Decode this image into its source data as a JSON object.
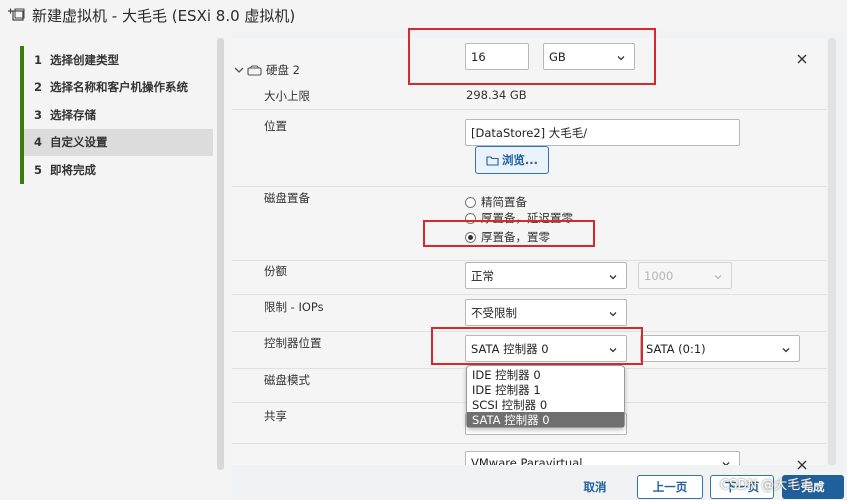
{
  "window": {
    "title": "新建虚拟机 - 大毛毛 (ESXi 8.0 虚拟机)"
  },
  "steps": [
    {
      "num": "1",
      "label": "选择创建类型"
    },
    {
      "num": "2",
      "label": "选择名称和客户机操作系统"
    },
    {
      "num": "3",
      "label": "选择存储"
    },
    {
      "num": "4",
      "label": "自定义设置"
    },
    {
      "num": "5",
      "label": "即将完成"
    }
  ],
  "disk": {
    "title": "硬盘 2",
    "size_value": "16",
    "size_unit": "GB",
    "max_label": "大小上限",
    "max_value": "298.34 GB",
    "location_label": "位置",
    "location_value": "[DataStore2] 大毛毛/",
    "browse_label": "浏览...",
    "provision_label": "磁盘置备",
    "provision_options": [
      "精简置备",
      "厚置备，延迟置零",
      "厚置备，置零"
    ],
    "shares_label": "份额",
    "shares_value": "正常",
    "shares_number": "1000",
    "limit_label": "限制 - IOPs",
    "limit_value": "不受限制",
    "controller_label": "控制器位置",
    "controller_value": "SATA 控制器 0",
    "controller_slot": "SATA (0:1)",
    "controller_options": [
      "IDE 控制器 0",
      "IDE 控制器 1",
      "SCSI 控制器 0",
      "SATA 控制器 0"
    ],
    "mode_label": "磁盘模式",
    "share_label": "共享"
  },
  "next_section": {
    "select_value": "VMware Paravirtual"
  },
  "footer": {
    "cancel": "取消",
    "back": "上一页",
    "next": "下一页",
    "finish": "完成"
  },
  "watermark": "CSDN @大毛毛~",
  "colors": {
    "accent": "#1f5f9b",
    "step_bar": "#3a7d0f",
    "highlight": "#d9272e"
  }
}
